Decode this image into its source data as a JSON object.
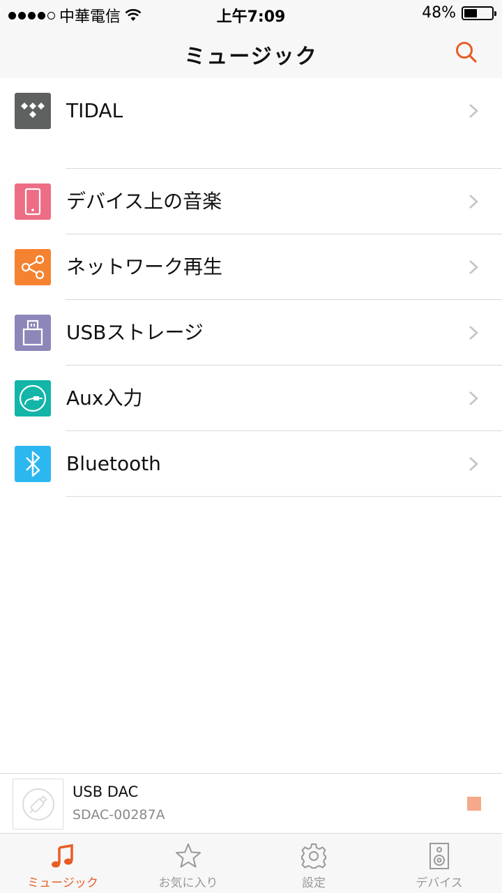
{
  "status_bar": {
    "carrier": "中華電信",
    "time": "上午7:09",
    "battery": "48%",
    "battery_level": 0.48
  },
  "nav": {
    "title": "ミュージック",
    "search_icon": "search-icon"
  },
  "sources": [
    {
      "label": "TIDAL",
      "icon": "tidal-icon",
      "color": "#5f6161"
    },
    {
      "label": "デバイス上の音楽",
      "icon": "phone-icon",
      "color": "#ec6d84"
    },
    {
      "label": "ネットワーク再生",
      "icon": "share-icon",
      "color": "#f58230"
    },
    {
      "label": "USBストレージ",
      "icon": "usb-icon",
      "color": "#8c87b8"
    },
    {
      "label": "Aux入力",
      "icon": "aux-cable-icon",
      "color": "#12b5a8"
    },
    {
      "label": "Bluetooth",
      "icon": "bluetooth-icon",
      "color": "#2db7f0"
    }
  ],
  "now_playing": {
    "title": "USB DAC",
    "subtitle": "SDAC-00287A",
    "art_icon": "usb-dac-placeholder-icon",
    "stop_icon": "stop-icon",
    "stop_color": "#f5a98a"
  },
  "tabs": [
    {
      "label": "ミュージック",
      "icon": "music-note-icon",
      "active": true
    },
    {
      "label": "お気に入り",
      "icon": "star-icon",
      "active": false
    },
    {
      "label": "設定",
      "icon": "gear-icon",
      "active": false
    },
    {
      "label": "デバイス",
      "icon": "speaker-icon",
      "active": false
    }
  ],
  "accent_color": "#e85c25"
}
